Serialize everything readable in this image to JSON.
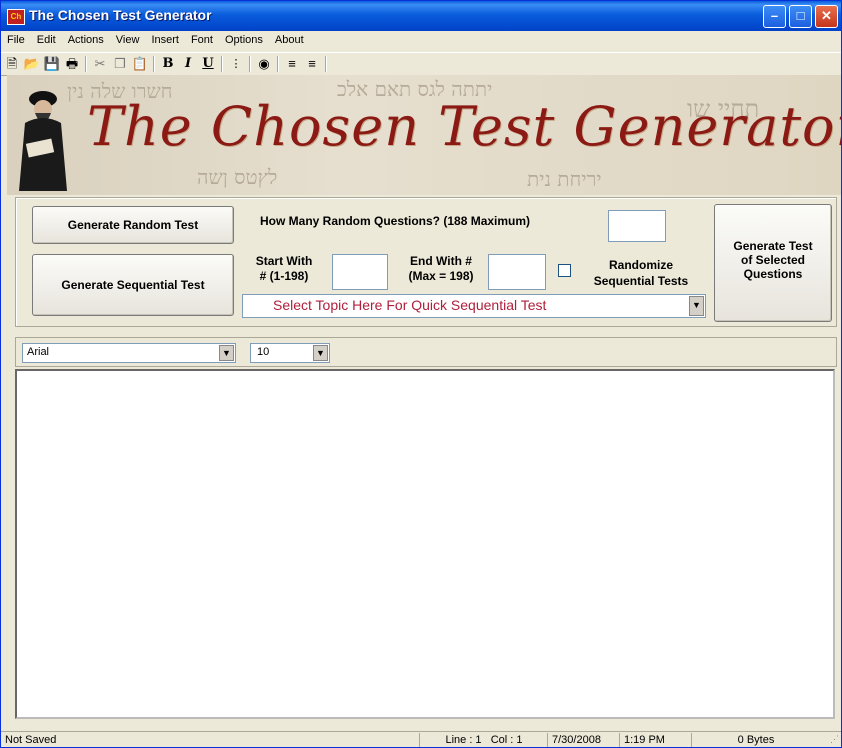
{
  "window": {
    "title": "The Chosen Test Generator",
    "icon_text": "Ch"
  },
  "menu": [
    "File",
    "Edit",
    "Actions",
    "View",
    "Insert",
    "Font",
    "Options",
    "About"
  ],
  "toolbar": {
    "bold": "B",
    "italic": "I",
    "underline": "U"
  },
  "banner": {
    "title": "The Chosen Test Generator"
  },
  "panel": {
    "random_button": "Generate Random Test",
    "how_many_label": "How Many Random Questions? (188 Maximum)",
    "how_many_value": "",
    "sequential_button": "Generate Sequential Test",
    "start_label_1": "Start With",
    "start_label_2": "# (1-198)",
    "start_value": "",
    "end_label_1": "End With #",
    "end_label_2": "(Max = 198)",
    "end_value": "",
    "randomize_label_1": "Randomize",
    "randomize_label_2": "Sequential Tests",
    "topic_select": "Select Topic Here For Quick Sequential Test",
    "selected_button_1": "Generate Test",
    "selected_button_2": "of Selected",
    "selected_button_3": "Questions"
  },
  "fontbar": {
    "font": "Arial",
    "size": "10"
  },
  "status": {
    "saved": "Not Saved",
    "position": "Line : 1   Col : 1",
    "date": "7/30/2008",
    "time": "1:19 PM",
    "size": "0 Bytes"
  },
  "colors": {
    "title_bar": "#0a5ddc",
    "banner_text": "#8b1a14",
    "topic_text": "#b0203c"
  }
}
